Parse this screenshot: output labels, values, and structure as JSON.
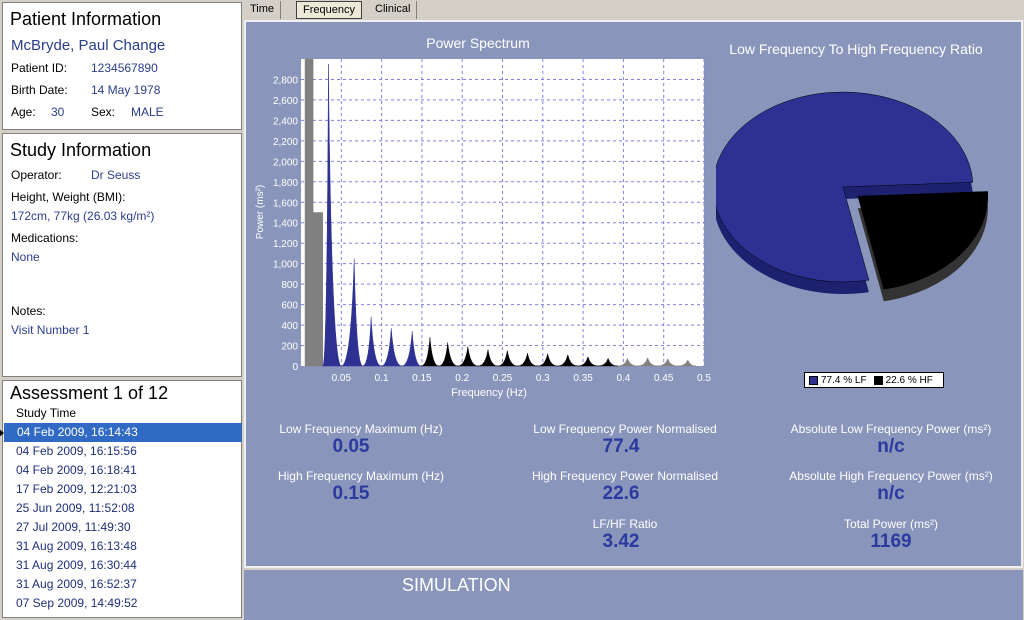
{
  "patient": {
    "heading": "Patient Information",
    "name": "McBryde, Paul Change",
    "id_label": "Patient ID:",
    "id_value": "1234567890",
    "dob_label": "Birth Date:",
    "dob_value": "14 May 1978",
    "age_label": "Age:",
    "age_value": "30",
    "sex_label": "Sex:",
    "sex_value": "MALE"
  },
  "study": {
    "heading": "Study Information",
    "operator_label": "Operator:",
    "operator_value": "Dr Seuss",
    "hw_label": "Height, Weight (BMI):",
    "hw_value": "172cm, 77kg (26.03 kg/m²)",
    "meds_label": "Medications:",
    "meds_value": "None",
    "notes_label": "Notes:",
    "notes_value": "Visit Number 1"
  },
  "assessment": {
    "heading": "Assessment 1 of 12",
    "column": "Study Time",
    "items": [
      "04 Feb 2009, 16:14:43",
      "04 Feb 2009, 16:15:56",
      "04 Feb 2009, 16:18:41",
      "17 Feb 2009, 12:21:03",
      "25 Jun 2009, 11:52:08",
      "27 Jul 2009, 11:49:30",
      "31 Aug 2009, 16:13:48",
      "31 Aug 2009, 16:30:44",
      "31 Aug 2009, 16:52:37",
      "07 Sep 2009, 14:49:52"
    ]
  },
  "tabs": [
    "Time",
    "Frequency",
    "Clinical"
  ],
  "active_tab": "Frequency",
  "stats": {
    "lf_max_label": "Low Frequency Maximum (Hz)",
    "lf_max_value": "0.05",
    "hf_max_label": "High Frequency Maximum (Hz)",
    "hf_max_value": "0.15",
    "lf_norm_label": "Low Frequency Power Normalised",
    "lf_norm_value": "77.4",
    "hf_norm_label": "High Frequency Power Normalised",
    "hf_norm_value": "22.6",
    "ratio_label": "LF/HF Ratio",
    "ratio_value": "3.42",
    "abs_lf_label": "Absolute Low Frequency Power (ms²)",
    "abs_lf_value": "n/c",
    "abs_hf_label": "Absolute High Frequency Power (ms²)",
    "abs_hf_value": "n/c",
    "total_label": "Total Power (ms²)",
    "total_value": "1169"
  },
  "footer": {
    "simulation": "SIMULATION"
  },
  "colors": {
    "lf": "#2e3192",
    "hf": "#000000",
    "vlf": "#808080",
    "panel": "#8a95bb"
  },
  "chart_data": [
    {
      "type": "area",
      "title": "Power Spectrum",
      "xlabel": "Frequency (Hz)",
      "ylabel": "Power (ms²)",
      "xlim": [
        0,
        0.5
      ],
      "ylim": [
        0,
        3000
      ],
      "xticks": [
        "0.05",
        "0.1",
        "0.15",
        "0.2",
        "0.25",
        "0.3",
        "0.35",
        "0.4",
        "0.45",
        "0.5"
      ],
      "yticks": [
        "0",
        "200",
        "400",
        "600",
        "800",
        "1,000",
        "1,200",
        "1,400",
        "1,600",
        "1,800",
        "2,000",
        "2,200",
        "2,400",
        "2,600",
        "2,800"
      ],
      "grid": true,
      "peaks": [
        {
          "x": 0.01,
          "y": 3000,
          "band": "vlf"
        },
        {
          "x": 0.02,
          "y": 1500,
          "band": "vlf"
        },
        {
          "x": 0.034,
          "y": 2950,
          "band": "lf"
        },
        {
          "x": 0.066,
          "y": 1050,
          "band": "lf"
        },
        {
          "x": 0.087,
          "y": 480,
          "band": "lf"
        },
        {
          "x": 0.112,
          "y": 370,
          "band": "lf"
        },
        {
          "x": 0.138,
          "y": 340,
          "band": "lf"
        },
        {
          "x": 0.16,
          "y": 280,
          "band": "hf"
        },
        {
          "x": 0.182,
          "y": 230,
          "band": "hf"
        },
        {
          "x": 0.207,
          "y": 190,
          "band": "hf"
        },
        {
          "x": 0.232,
          "y": 160,
          "band": "hf"
        },
        {
          "x": 0.256,
          "y": 150,
          "band": "hf"
        },
        {
          "x": 0.281,
          "y": 125,
          "band": "hf"
        },
        {
          "x": 0.306,
          "y": 120,
          "band": "hf"
        },
        {
          "x": 0.331,
          "y": 110,
          "band": "hf"
        },
        {
          "x": 0.356,
          "y": 90,
          "band": "hf"
        },
        {
          "x": 0.381,
          "y": 75,
          "band": "hf"
        },
        {
          "x": 0.405,
          "y": 75,
          "band": "vlf"
        },
        {
          "x": 0.43,
          "y": 80,
          "band": "vlf"
        },
        {
          "x": 0.455,
          "y": 70,
          "band": "vlf"
        },
        {
          "x": 0.48,
          "y": 60,
          "band": "vlf"
        }
      ]
    },
    {
      "type": "pie",
      "title": "Low Frequency To High Frequency Ratio",
      "series": [
        {
          "name": "77.4 % LF",
          "value": 77.4
        },
        {
          "name": "22.6 % HF",
          "value": 22.6
        }
      ],
      "legend": "bottom"
    }
  ]
}
